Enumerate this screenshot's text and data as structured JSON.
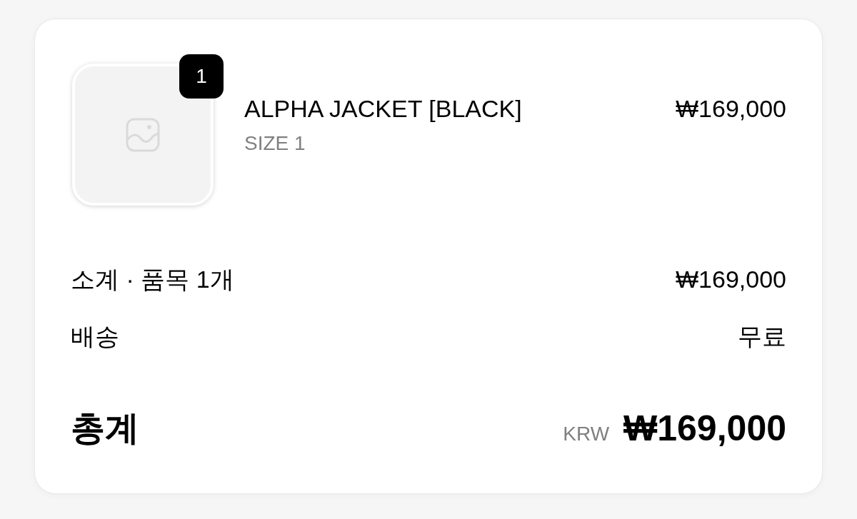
{
  "items": [
    {
      "name": "ALPHA JACKET [BLACK]",
      "variant": "SIZE 1",
      "price": "₩169,000",
      "quantity": "1"
    }
  ],
  "summary": [
    {
      "label": "소계 · 품목 1개",
      "value": "₩169,000"
    },
    {
      "label": "배송",
      "value": "무료"
    }
  ],
  "total": {
    "label": "총계",
    "currency": "KRW",
    "value": "₩169,000"
  }
}
